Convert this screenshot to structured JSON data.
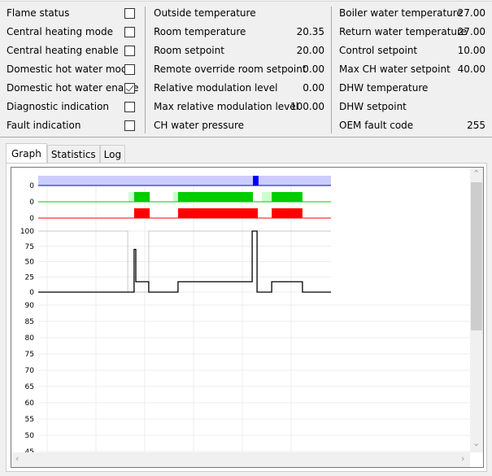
{
  "status_flags": [
    {
      "label": "Flame status",
      "checked": false
    },
    {
      "label": "Central heating mode",
      "checked": false
    },
    {
      "label": "Central heating enable",
      "checked": false
    },
    {
      "label": "Domestic hot water mode",
      "checked": false
    },
    {
      "label": "Domestic hot water enable",
      "checked": true
    },
    {
      "label": "Diagnostic indication",
      "checked": false
    },
    {
      "label": "Fault indication",
      "checked": false
    }
  ],
  "room_values": [
    {
      "label": "Outside temperature",
      "value": ""
    },
    {
      "label": "Room temperature",
      "value": "20.35"
    },
    {
      "label": "Room setpoint",
      "value": "20.00"
    },
    {
      "label": "Remote override room setpoint",
      "value": "0.00"
    },
    {
      "label": "Relative modulation level",
      "value": "0.00"
    },
    {
      "label": "Max relative modulation level",
      "value": "100.00"
    },
    {
      "label": "CH water pressure",
      "value": ""
    }
  ],
  "boiler_values": [
    {
      "label": "Boiler water temperature",
      "value": "27.00"
    },
    {
      "label": "Return water temperature",
      "value": "27.00"
    },
    {
      "label": "Control setpoint",
      "value": "10.00"
    },
    {
      "label": "Max CH water setpoint",
      "value": "40.00"
    },
    {
      "label": "DHW temperature",
      "value": ""
    },
    {
      "label": "DHW setpoint",
      "value": ""
    },
    {
      "label": "OEM fault code",
      "value": "255"
    }
  ],
  "tabs": [
    {
      "label": "Graph",
      "active": true
    },
    {
      "label": "Statistics"
    },
    {
      "label": "Log"
    }
  ],
  "chart_data": {
    "type": "line",
    "colors": {
      "blue_band": "#ccccff",
      "blue": "#0000ff",
      "green": "#00cc00",
      "green_light": "#ccffcc",
      "red": "#ff0000",
      "gray": "#c8c8c8",
      "black": "#000000"
    },
    "lanes": [
      {
        "tick": "0",
        "color": "blue",
        "on": [
          [
            88,
            90.3
          ]
        ]
      },
      {
        "tick": "0",
        "color": "green",
        "pre": [
          [
            37,
            39.3
          ],
          [
            55.3,
            57.3
          ],
          [
            91.7,
            95.7
          ]
        ],
        "on": [
          [
            39.3,
            45.7
          ],
          [
            57.3,
            88
          ],
          [
            95.7,
            108.3
          ]
        ]
      },
      {
        "tick": "0",
        "color": "red",
        "on": [
          [
            39.3,
            45.7
          ],
          [
            57.3,
            90
          ],
          [
            95.7,
            108.3
          ]
        ]
      }
    ],
    "modulation": {
      "yticks": [
        "100",
        "75",
        "50",
        "25",
        "0"
      ],
      "ylim": [
        0,
        100
      ],
      "xlim": [
        0,
        120
      ],
      "gray": [
        [
          0,
          100
        ],
        [
          36.7,
          100
        ],
        [
          36.7,
          0
        ],
        [
          45.3,
          0
        ],
        [
          45.3,
          100
        ],
        [
          120,
          100
        ]
      ],
      "black": [
        [
          0,
          0
        ],
        [
          39.3,
          0
        ],
        [
          39.3,
          70
        ],
        [
          40,
          70
        ],
        [
          40,
          17
        ],
        [
          45.3,
          17
        ],
        [
          45.3,
          0
        ],
        [
          57.3,
          0
        ],
        [
          57.3,
          17
        ],
        [
          87.7,
          17
        ],
        [
          87.7,
          100
        ],
        [
          89.7,
          100
        ],
        [
          89.7,
          0
        ],
        [
          95.7,
          0
        ],
        [
          95.7,
          17
        ],
        [
          108.3,
          17
        ],
        [
          108.3,
          0
        ],
        [
          120,
          0
        ]
      ]
    },
    "temperature": {
      "yticks": [
        "90",
        "85",
        "80",
        "75",
        "70",
        "65",
        "60",
        "55",
        "50",
        "45"
      ]
    }
  }
}
